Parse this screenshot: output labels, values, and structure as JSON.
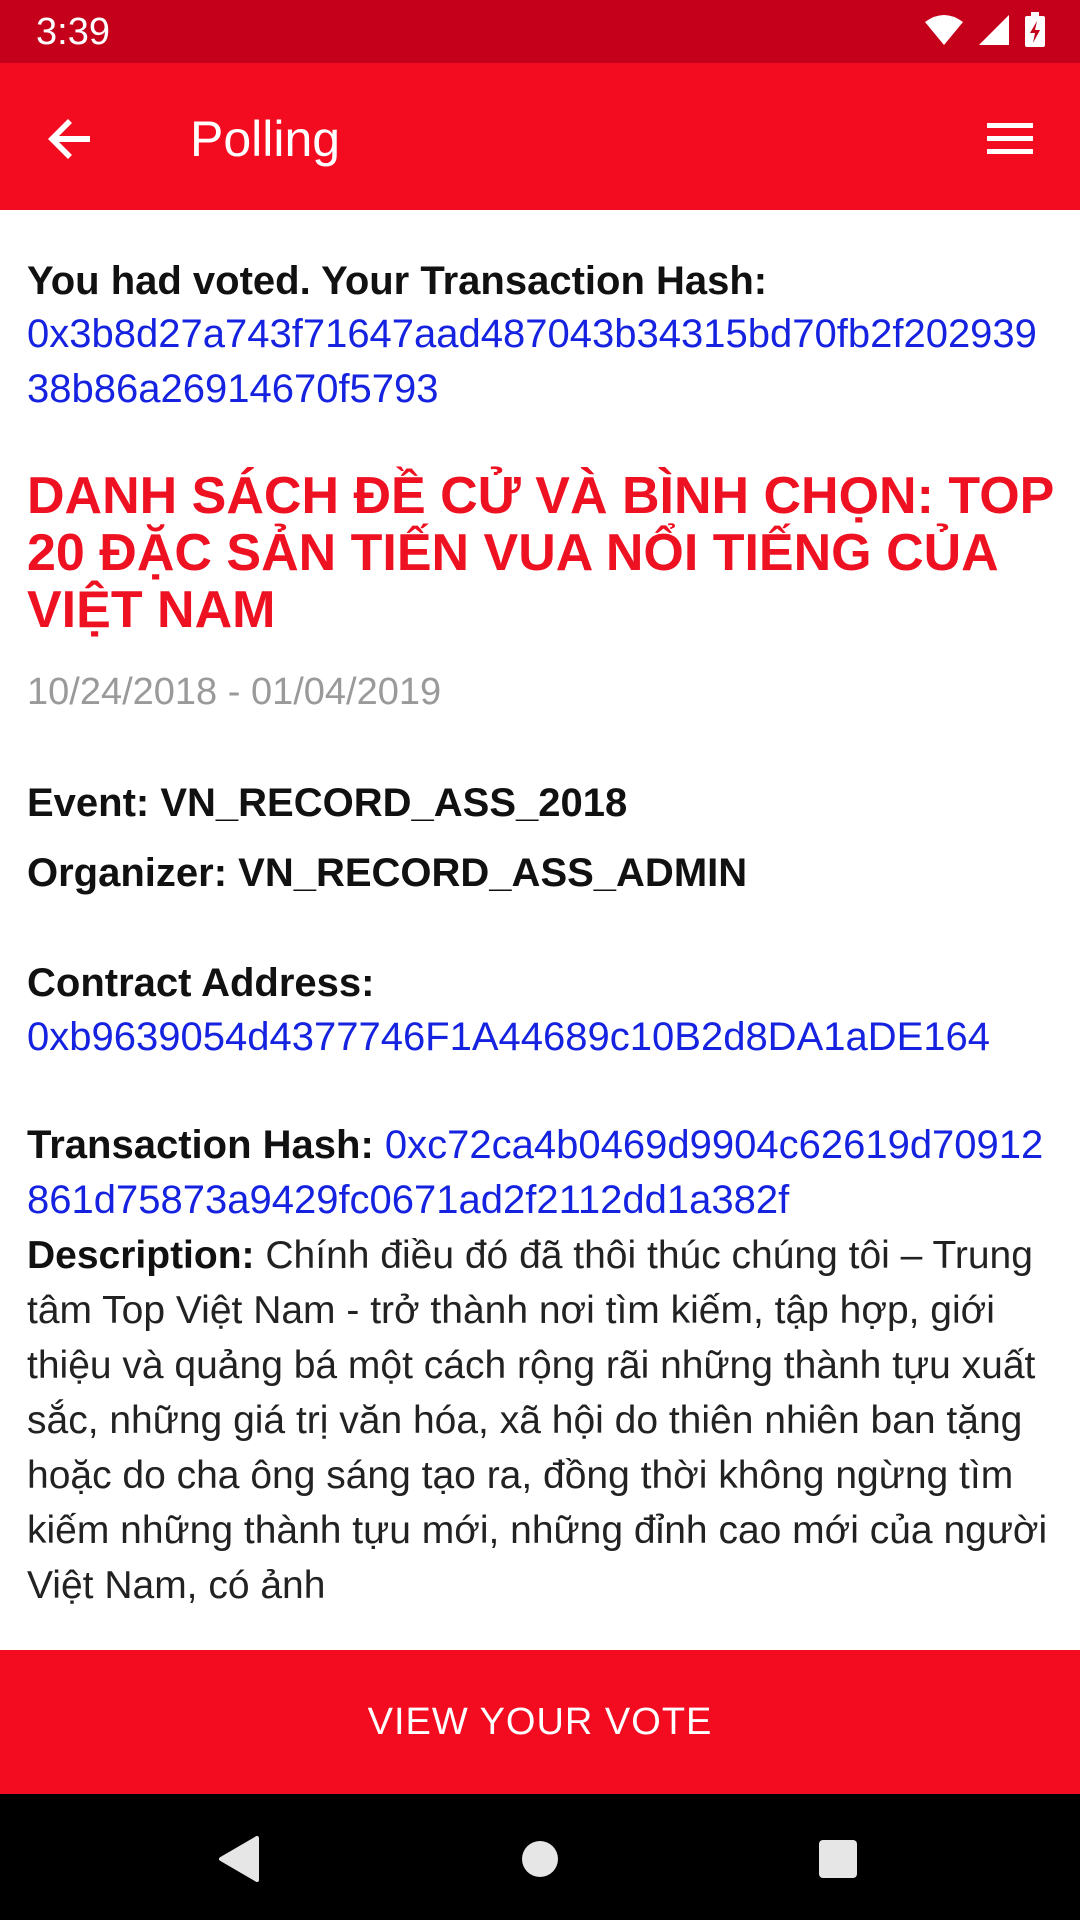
{
  "status_bar": {
    "time": "3:39",
    "icons": [
      "wifi-icon",
      "signal-icon",
      "battery-icon"
    ],
    "background": "#C5001A"
  },
  "app_bar": {
    "title": "Polling",
    "back_icon": "arrow-back-icon",
    "menu_icon": "hamburger-menu-icon",
    "background": "#F30B20"
  },
  "vote_info": {
    "label": "You had voted. Your Transaction Hash:",
    "hash": "0x3b8d27a743f71647aad487043b34315bd70fb2f20293938b86a26914670f5793"
  },
  "poll": {
    "title": "DANH SÁCH ĐỀ CỬ VÀ BÌNH CHỌN: TOP 20 ĐẶC SẢN TIẾN VUA NỔI TIẾNG CỦA VIỆT NAM",
    "dates": "10/24/2018 - 01/04/2019",
    "event": "Event: VN_RECORD_ASS_2018",
    "organizer": "Organizer: VN_RECORD_ASS_ADMIN",
    "contract_label": "Contract Address:",
    "contract_address": "0xb9639054d4377746F1A44689c10B2d8DA1aDE164",
    "tx_label": "Transaction Hash:",
    "tx_hash": "0xc72ca4b0469d9904c62619d70912861d75873a9429fc0671ad2f2112dd1a382f",
    "description_label": "Description:",
    "description": "Chính điều đó đã thôi thúc chúng tôi – Trung tâm Top Việt Nam - trở thành nơi tìm kiếm, tập hợp, giới thiệu và quảng bá một cách rộng rãi những thành tựu xuất sắc, những giá trị văn hóa, xã hội do thiên nhiên ban tặng hoặc do cha ông sáng tạo ra, đồng thời không ngừng tìm kiếm những thành tựu mới, những đỉnh cao mới của người Việt Nam, có ảnh"
  },
  "actions": {
    "view_vote_label": "VIEW YOUR VOTE"
  },
  "nav_bar": {
    "icons": [
      "nav-back-icon",
      "nav-home-icon",
      "nav-recents-icon"
    ]
  },
  "colors": {
    "accent": "#F30B20",
    "title_red": "#EE1122",
    "link_blue": "#1522E0",
    "muted_gray": "#9a9a9a"
  }
}
